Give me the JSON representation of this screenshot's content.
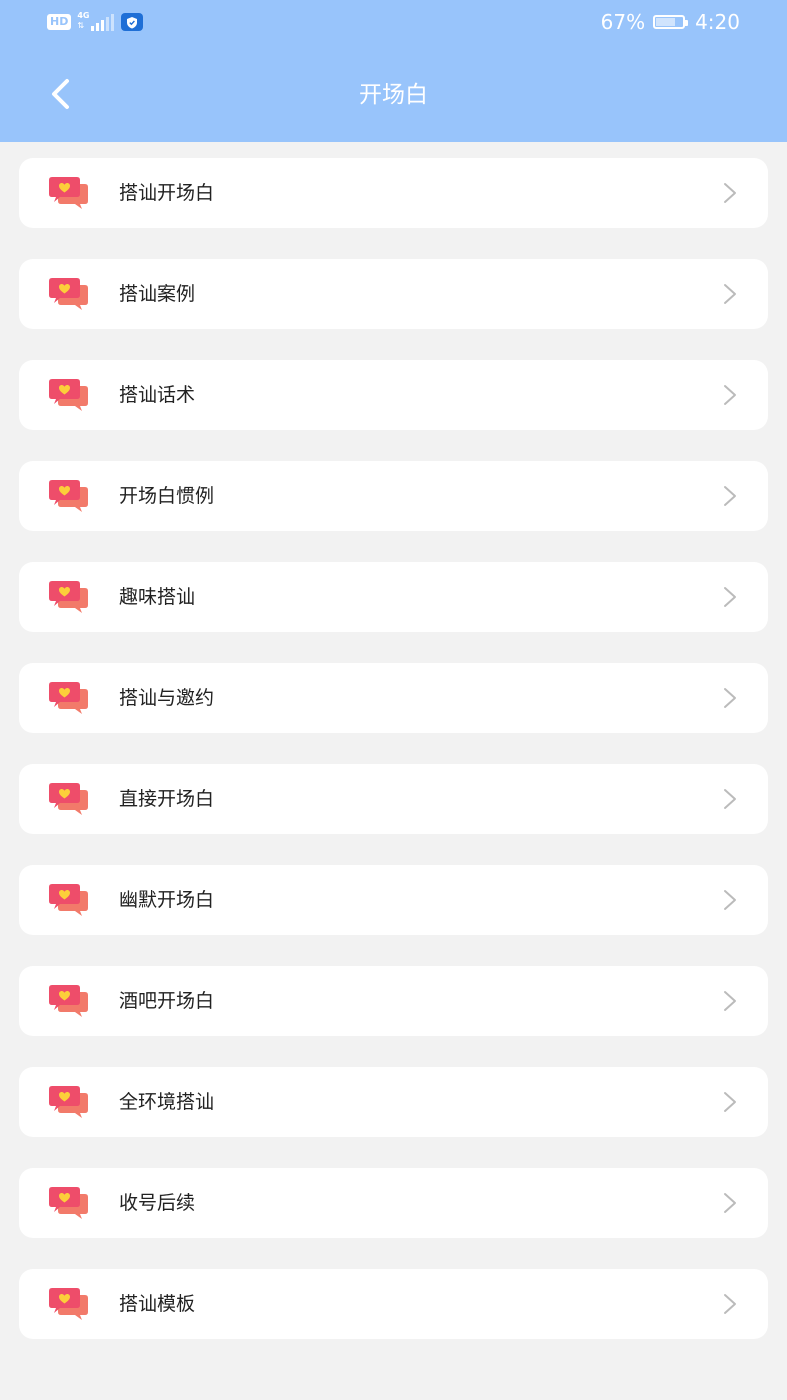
{
  "status_bar": {
    "hd": "HD",
    "network": "4G",
    "battery_text": "67%",
    "battery_level": 0.67,
    "time": "4:20"
  },
  "header": {
    "title": "开场白",
    "back_icon": "chevron-left-icon"
  },
  "colors": {
    "header_bg": "#98c4fb",
    "page_bg": "#f2f2f2",
    "card_bg": "#ffffff",
    "icon_back": "#f27a6a",
    "icon_front": "#ee4d6a",
    "icon_heart": "#fccf3a",
    "chevron": "#bbbbbb"
  },
  "menu": {
    "items": [
      {
        "label": "搭讪开场白",
        "icon": "chat-heart-icon"
      },
      {
        "label": "搭讪案例",
        "icon": "chat-heart-icon"
      },
      {
        "label": "搭讪话术",
        "icon": "chat-heart-icon"
      },
      {
        "label": "开场白惯例",
        "icon": "chat-heart-icon"
      },
      {
        "label": "趣味搭讪",
        "icon": "chat-heart-icon"
      },
      {
        "label": "搭讪与邀约",
        "icon": "chat-heart-icon"
      },
      {
        "label": "直接开场白",
        "icon": "chat-heart-icon"
      },
      {
        "label": "幽默开场白",
        "icon": "chat-heart-icon"
      },
      {
        "label": "酒吧开场白",
        "icon": "chat-heart-icon"
      },
      {
        "label": "全环境搭讪",
        "icon": "chat-heart-icon"
      },
      {
        "label": "收号后续",
        "icon": "chat-heart-icon"
      },
      {
        "label": "搭讪模板",
        "icon": "chat-heart-icon"
      }
    ]
  }
}
